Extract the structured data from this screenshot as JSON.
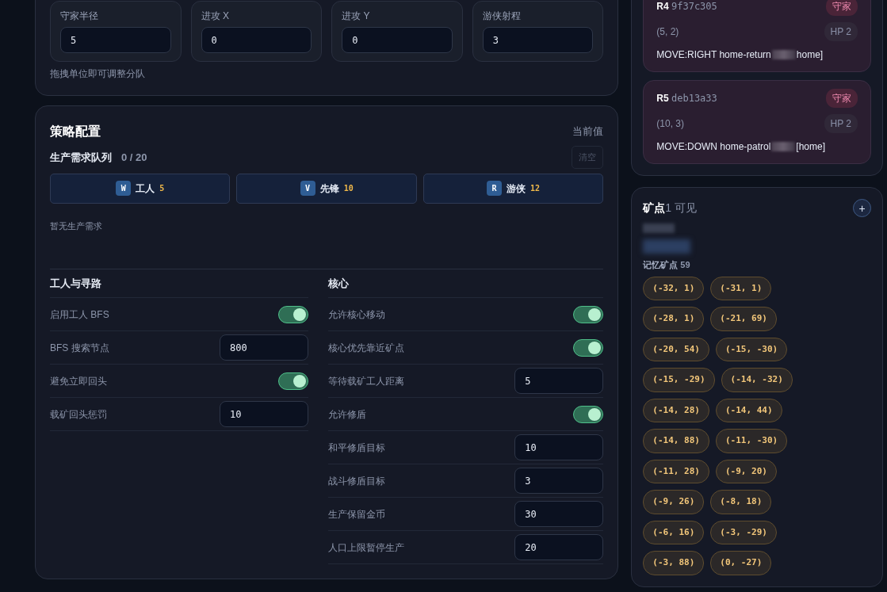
{
  "unit_settings": {
    "fields": [
      {
        "label": "守家半径",
        "value": "5"
      },
      {
        "label": "进攻 X",
        "value": "0"
      },
      {
        "label": "进攻 Y",
        "value": "0"
      },
      {
        "label": "游侠射程",
        "value": "3"
      }
    ],
    "hint": "拖拽单位即可调整分队"
  },
  "strategy": {
    "title": "策略配置",
    "current_label": "当前值",
    "queue_title": "生产需求队列",
    "queue_count": "0 / 20",
    "clear_button": {
      "label": "清空",
      "disabled": true
    },
    "unit_buttons": [
      {
        "key": "W",
        "name": "工人",
        "cost": "5"
      },
      {
        "key": "V",
        "name": "先锋",
        "cost": "10"
      },
      {
        "key": "R",
        "name": "游侠",
        "cost": "12"
      }
    ],
    "empty_text": "暂无生产需求",
    "sections": [
      {
        "title": "工人与寻路",
        "settings": [
          {
            "kind": "toggle",
            "label": "启用工人 BFS",
            "on": true
          },
          {
            "kind": "number",
            "label": "BFS 搜索节点",
            "value": "800"
          },
          {
            "kind": "toggle",
            "label": "避免立即回头",
            "on": true
          },
          {
            "kind": "number",
            "label": "载矿回头惩罚",
            "value": "10"
          }
        ]
      },
      {
        "title": "核心",
        "settings": [
          {
            "kind": "toggle",
            "label": "允许核心移动",
            "on": true
          },
          {
            "kind": "toggle",
            "label": "核心优先靠近矿点",
            "on": true
          },
          {
            "kind": "number",
            "label": "等待载矿工人距离",
            "value": "5"
          },
          {
            "kind": "toggle",
            "label": "允许修盾",
            "on": true
          },
          {
            "kind": "number",
            "label": "和平修盾目标",
            "value": "10"
          },
          {
            "kind": "number",
            "label": "战斗修盾目标",
            "value": "3"
          },
          {
            "kind": "number",
            "label": "生产保留金币",
            "value": "30"
          },
          {
            "kind": "number",
            "label": "人口上限暂停生产",
            "value": "20"
          }
        ]
      }
    ]
  },
  "units": [
    {
      "id": "R4",
      "hash": "9f37c305",
      "role": "守家",
      "position": "(5, 2)",
      "hp": "HP 2",
      "command": "MOVE:RIGHT home-return",
      "command_tail": "home]"
    },
    {
      "id": "R5",
      "hash": "deb13a33",
      "role": "守家",
      "position": "(10, 3)",
      "hp": "HP 2",
      "command": "MOVE:DOWN home-patrol",
      "command_tail": "[home]"
    }
  ],
  "ores": {
    "title": "矿点",
    "visible": "1 可见",
    "add_button": "+",
    "memory_label": "记忆矿点",
    "memory_count": "59",
    "points": [
      "(-32, 1)",
      "(-31, 1)",
      "(-28, 1)",
      "(-21, 69)",
      "(-20, 54)",
      "(-15, -30)",
      "(-15, -29)",
      "(-14, -32)",
      "(-14, 28)",
      "(-14, 44)",
      "(-14, 88)",
      "(-11, -30)",
      "(-11, 28)",
      "(-9, 20)",
      "(-9, 26)",
      "(-8, 18)",
      "(-6, 16)",
      "(-3, -29)",
      "(-3, 88)",
      "(0, -27)"
    ]
  }
}
